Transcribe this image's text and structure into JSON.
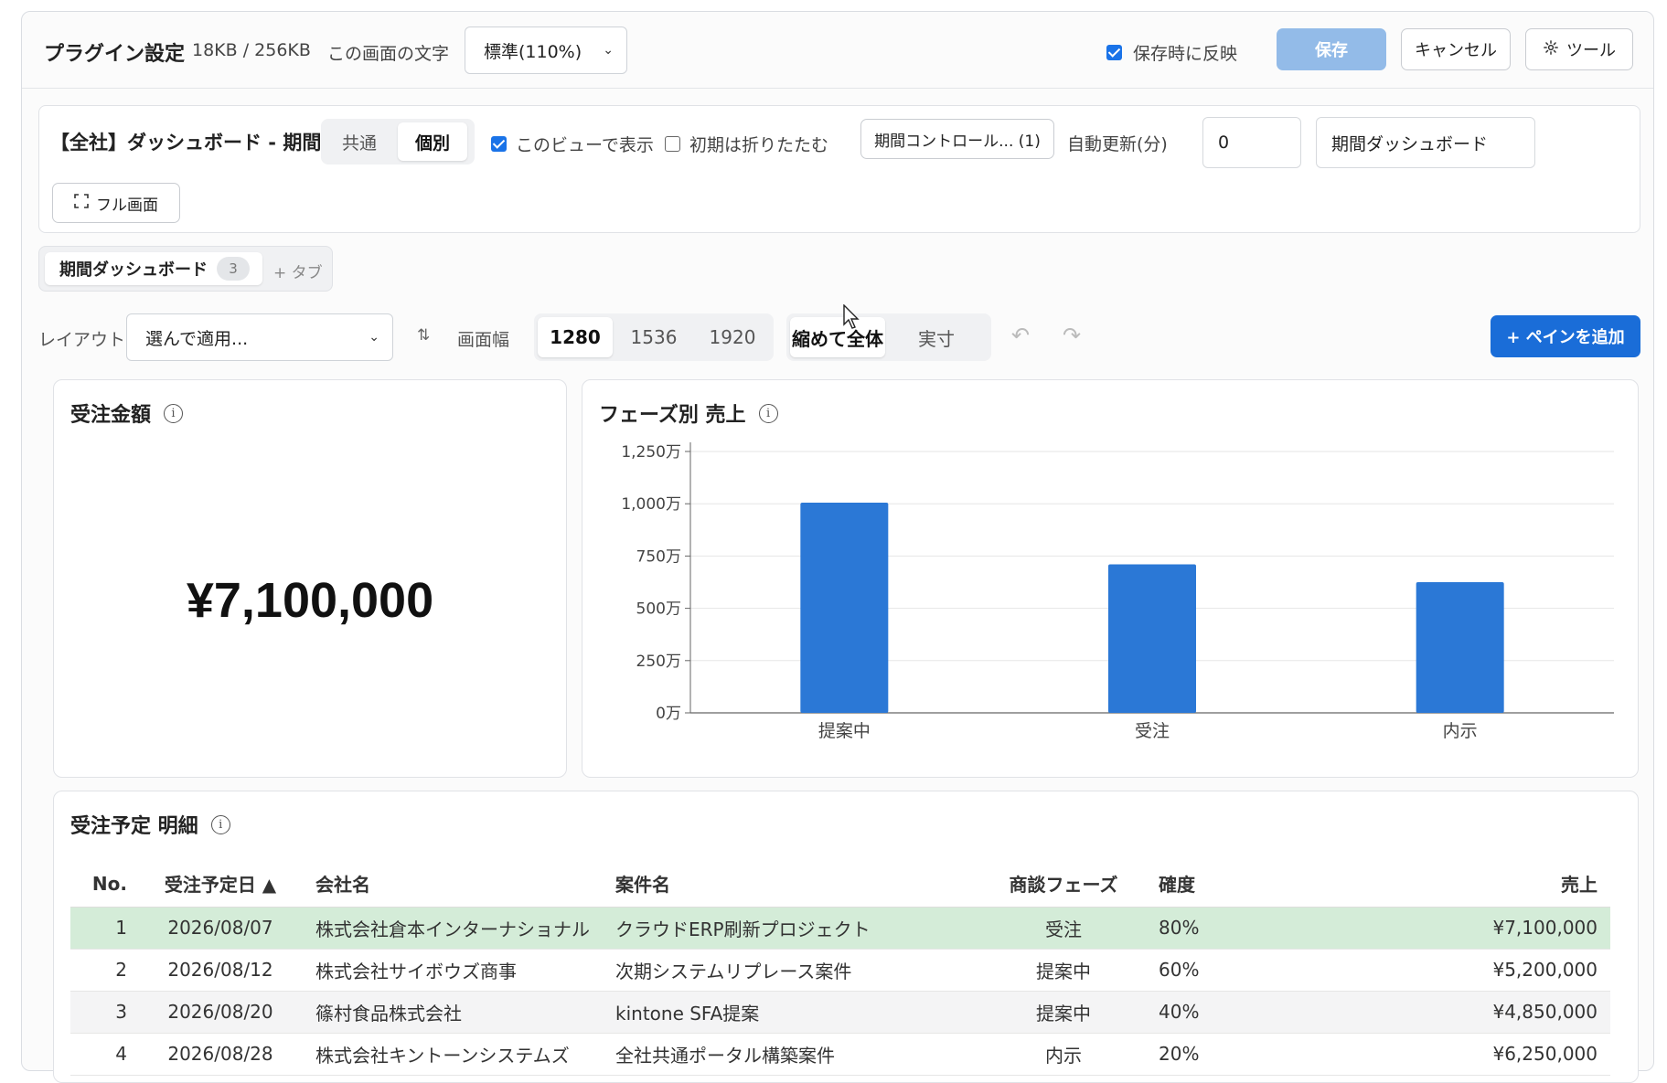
{
  "header": {
    "title": "プラグイン設定",
    "size": "18KB / 256KB",
    "font_label": "この画面の文字",
    "font_select": "標準(110%)",
    "reflect_label": "保存時に反映",
    "save": "保存",
    "cancel": "キャンセル",
    "tool": "ツール"
  },
  "config": {
    "title": "【全社】ダッシュボード - 期間",
    "scope_options": [
      "共通",
      "個別"
    ],
    "scope_selected": "個別",
    "show_in_view": "このビューで表示",
    "collapse_initial": "初期は折りたたむ",
    "period_control": "期間コントロール... (1)",
    "auto_refresh_label": "自動更新(分)",
    "auto_refresh_value": "0",
    "dashboard_name": "期間ダッシュボード",
    "fullscreen": "フル画面"
  },
  "tabs": {
    "active_label": "期間ダッシュボード",
    "active_count": "3",
    "add": "+ タブ"
  },
  "toolbar": {
    "layout_label": "レイアウト",
    "layout_select": "選んで適用...",
    "width_label": "画面幅",
    "widths": [
      "1280",
      "1536",
      "1920"
    ],
    "width_selected": "1280",
    "fit_options": [
      "縮めて全体",
      "実寸"
    ],
    "fit_selected": "縮めて全体",
    "add_pane": "+ ペインを追加"
  },
  "kpi": {
    "title": "受注金額",
    "value": "¥7,100,000"
  },
  "chart_pane": {
    "title": "フェーズ別 売上"
  },
  "chart_data": {
    "type": "bar",
    "title": "フェーズ別 売上",
    "categories": [
      "提案中",
      "受注",
      "内示"
    ],
    "values": [
      10050000,
      7100000,
      6250000
    ],
    "y_tick_labels": [
      "0万",
      "250万",
      "500万",
      "750万",
      "1,000万",
      "1,250万"
    ],
    "y_ticks": [
      0,
      2500000,
      5000000,
      7500000,
      10000000,
      12500000
    ],
    "ylim": [
      0,
      12500000
    ],
    "grid": true,
    "color": "#2b78d6"
  },
  "table_pane": {
    "title": "受注予定 明細",
    "columns": [
      "No.",
      "受注予定日 ▲",
      "会社名",
      "案件名",
      "商談フェーズ",
      "確度",
      "売上"
    ],
    "rows": [
      {
        "no": "1",
        "date": "2026/08/07",
        "company": "株式会社倉本インターナショナル",
        "case": "クラウドERP刷新プロジェクト",
        "phase": "受注",
        "prob": "80%",
        "amount": "¥7,100,000"
      },
      {
        "no": "2",
        "date": "2026/08/12",
        "company": "株式会社サイボウズ商事",
        "case": "次期システムリプレース案件",
        "phase": "提案中",
        "prob": "60%",
        "amount": "¥5,200,000"
      },
      {
        "no": "3",
        "date": "2026/08/20",
        "company": "篠村食品株式会社",
        "case": "kintone SFA提案",
        "phase": "提案中",
        "prob": "40%",
        "amount": "¥4,850,000"
      },
      {
        "no": "4",
        "date": "2026/08/28",
        "company": "株式会社キントーンシステムズ",
        "case": "全社共通ポータル構築案件",
        "phase": "内示",
        "prob": "20%",
        "amount": "¥6,250,000"
      }
    ]
  }
}
